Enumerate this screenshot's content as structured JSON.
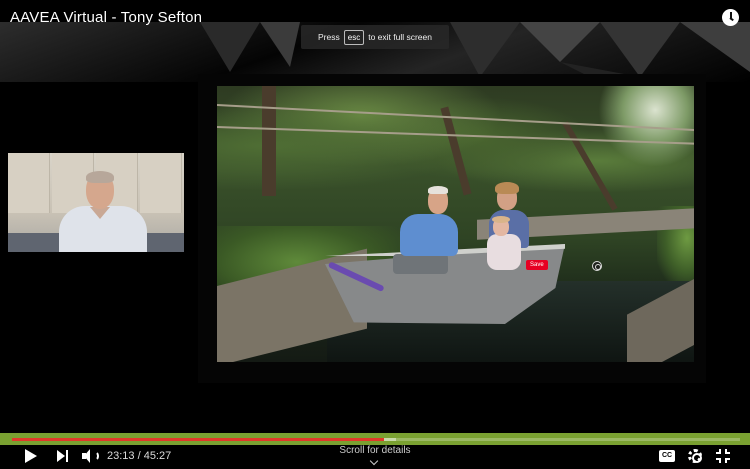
{
  "window": {
    "title": "AAVEA Virtual - Tony Sefton"
  },
  "toast": {
    "prefix": "Press",
    "key": "esc",
    "suffix": "to exit full screen"
  },
  "slide": {
    "pinterest_save_label": "Save"
  },
  "player": {
    "current_time": "23:13",
    "duration": "45:27",
    "time_display": "23:13 / 45:27",
    "progress_fraction": 0.511,
    "buffer_fraction": 0.528,
    "scroll_label": "Scroll for details",
    "cc_label": "CC",
    "accent_color": "#e03a2a",
    "bar_color": "#7aa131"
  }
}
